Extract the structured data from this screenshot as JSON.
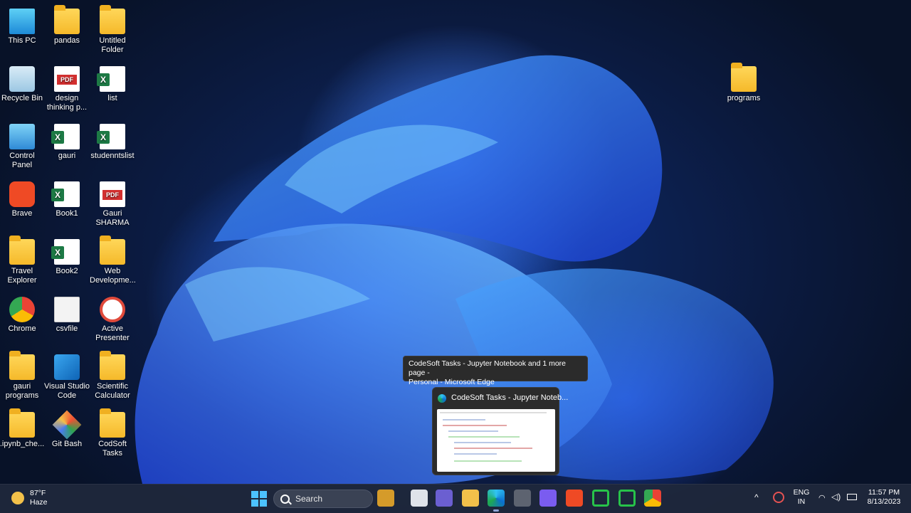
{
  "desktop": {
    "icons": [
      {
        "label": "This PC",
        "icon": "monitor-icon"
      },
      {
        "label": "pandas",
        "icon": "folder-icon"
      },
      {
        "label": "Untitled Folder",
        "icon": "folder-icon"
      },
      {
        "label": "Recycle Bin",
        "icon": "recycle-bin-icon"
      },
      {
        "label": "design thinking p...",
        "icon": "pdf-icon"
      },
      {
        "label": "list",
        "icon": "excel-icon"
      },
      {
        "label": "Control Panel",
        "icon": "control-panel-icon"
      },
      {
        "label": "gauri",
        "icon": "excel-icon"
      },
      {
        "label": "studenntslist",
        "icon": "excel-icon"
      },
      {
        "label": "Brave",
        "icon": "brave-icon"
      },
      {
        "label": "Book1",
        "icon": "excel-icon"
      },
      {
        "label": "Gauri SHARMA",
        "icon": "pdf-icon"
      },
      {
        "label": "Travel Explorer",
        "icon": "folder-icon"
      },
      {
        "label": "Book2",
        "icon": "excel-icon"
      },
      {
        "label": "Web Developme...",
        "icon": "folder-icon"
      },
      {
        "label": "Chrome",
        "icon": "chrome-icon"
      },
      {
        "label": "csvfile",
        "icon": "text-file-icon"
      },
      {
        "label": "Active Presenter",
        "icon": "active-presenter-icon"
      },
      {
        "label": "gauri programs",
        "icon": "folder-icon"
      },
      {
        "label": "Visual Studio Code",
        "icon": "vscode-icon"
      },
      {
        "label": "Scientific Calculator",
        "icon": "folder-icon"
      },
      {
        "label": ".ipynb_che...",
        "icon": "folder-icon"
      },
      {
        "label": "Git Bash",
        "icon": "git-bash-icon"
      },
      {
        "label": "CodSoft Tasks",
        "icon": "folder-icon"
      },
      {
        "label": "programs",
        "icon": "folder-icon"
      }
    ]
  },
  "tooltip": {
    "line1": "CodeSoft Tasks - Jupyter Notebook and 1 more page -",
    "line2": "Personal - Microsoft Edge"
  },
  "preview": {
    "title": "CodeSoft Tasks - Jupyter Noteb..."
  },
  "taskbar": {
    "weather_temp": "87°F",
    "weather_desc": "Haze",
    "search_label": "Search",
    "lang_line1": "ENG",
    "lang_line2": "IN",
    "time": "11:57 PM",
    "date": "8/13/2023",
    "apps": [
      "start-icon",
      "search-icon",
      "widgets-icon",
      "task-view-icon",
      "teams-icon",
      "file-explorer-icon",
      "edge-icon",
      "app-icon",
      "visual-studio-icon",
      "brave-icon",
      "progress-app-icon",
      "progress-app-icon",
      "chrome-icon"
    ]
  },
  "colors": {
    "taskbar_bg": "#20283c",
    "accent": "#4cc2ff",
    "folder": "#f5b92a",
    "excel": "#1d7a45",
    "pdf": "#d32f2f"
  }
}
